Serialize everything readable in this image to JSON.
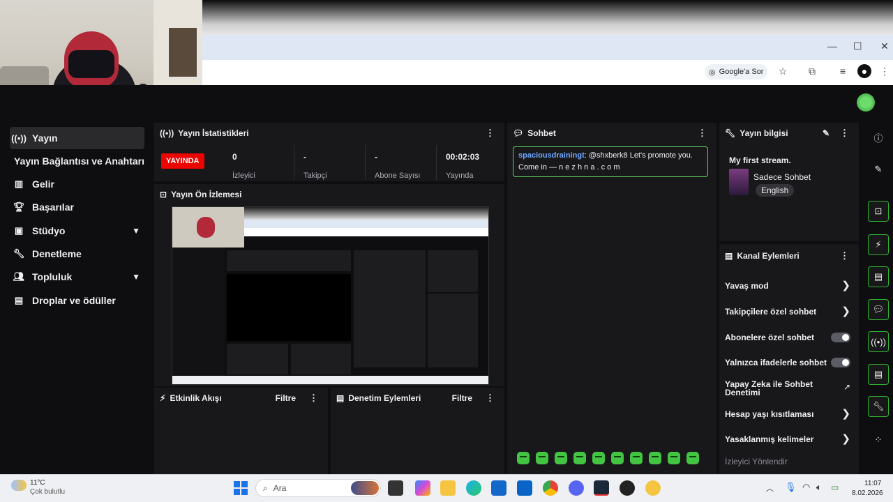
{
  "browser": {
    "google_chip": "Google'a Sor"
  },
  "sidebar": {
    "items": [
      {
        "label": "Yayın",
        "icon": "broadcast-icon",
        "active": true
      },
      {
        "label": "Yayın Bağlantısı ve Anahtarı"
      },
      {
        "label": "Gelir",
        "icon": "chart-icon"
      },
      {
        "label": "Başarılar",
        "icon": "trophy-icon"
      },
      {
        "label": "Stüdyo",
        "icon": "camera-icon"
      },
      {
        "label": "Denetleme",
        "icon": "wrench-icon"
      },
      {
        "label": "Topluluk",
        "icon": "people-icon"
      },
      {
        "label": "Droplar ve ödüller",
        "icon": "gift-icon"
      }
    ]
  },
  "stats": {
    "title": "Yayın İstatistikleri",
    "live_badge": "YAYINDA",
    "viewers_value": "0",
    "viewers_label": "İzleyici",
    "followers_value": "-",
    "followers_label": "Takipçi",
    "subs_value": "-",
    "subs_label": "Abone Sayısı",
    "uptime_value": "00:02:03",
    "uptime_label": "Yayında"
  },
  "preview": {
    "title": "Yayın Ön İzlemesi"
  },
  "activity": {
    "title": "Etkinlik Akışı",
    "filter": "Filtre"
  },
  "mod_log": {
    "title": "Denetim Eylemleri",
    "filter": "Filtre"
  },
  "chat": {
    "title": "Sohbet",
    "message_user": "spaciousdrainingt",
    "message_text": ": @shxberk8 Let's promote you. Come in — n e z h n a . c o m"
  },
  "stream_info": {
    "title": "Yayın bilgisi",
    "stream_title": "My first stream.",
    "category": "Sadece Sohbet",
    "language": "English"
  },
  "mod_actions": {
    "title": "Kanal Eylemleri",
    "items": [
      {
        "label": "Yavaş mod",
        "control": "chevron"
      },
      {
        "label": "Takipçilere özel sohbet",
        "control": "chevron"
      },
      {
        "label": "Abonelere özel sohbet",
        "control": "toggle",
        "on": false
      },
      {
        "label": "Yalnızca ifadelerle sohbet",
        "control": "toggle",
        "on": false
      },
      {
        "label": "Yapay Zeka ile Sohbet Denetimi",
        "control": "external"
      },
      {
        "label": "Hesap yaşı kısıtlaması",
        "control": "chevron"
      },
      {
        "label": "Yasaklanmış kelimeler",
        "control": "chevron"
      },
      {
        "label": "İzleyici Yönlendir",
        "control": "none"
      }
    ]
  },
  "taskbar": {
    "weather_temp": "11°C",
    "weather_desc": "Çok bulutlu",
    "search_placeholder": "Ara",
    "time": "11:07",
    "date": "8.02.2026"
  },
  "colors": {
    "accent_green": "#2fb32f",
    "live_red": "#eb0400",
    "chat_user_blue": "#6fa8ff"
  }
}
